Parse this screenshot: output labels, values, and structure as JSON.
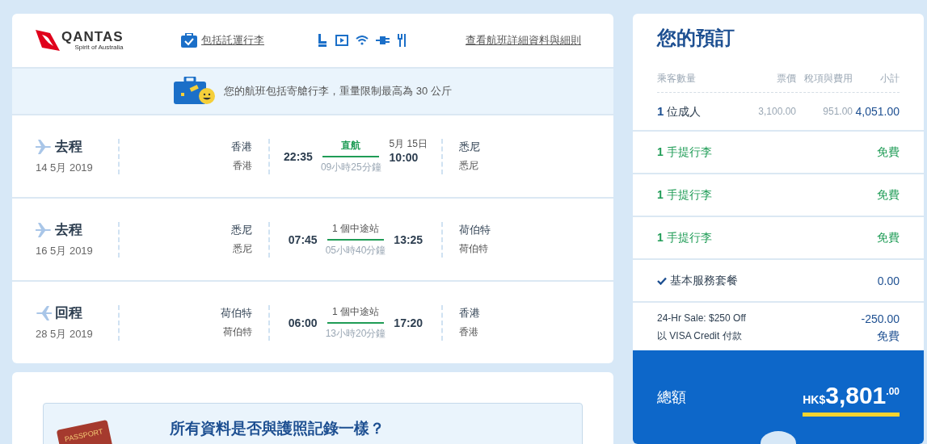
{
  "flight_card": {
    "logo": {
      "name": "QANTAS",
      "tagline": "Spirit of Australia"
    },
    "baggage_link": "包括託運行李",
    "details_link": "查看航班詳細資料與細則",
    "baggage_notice": "您的航班包括寄艙行李，重量限制最高為 30 公斤",
    "legs": [
      {
        "kind": "outbound",
        "label": "去程",
        "date": "14 5月 2019",
        "from_city": "香港",
        "from_airport": "香港",
        "depart": "22:35",
        "direct": true,
        "stops": "直航",
        "arrival_date": "5月 15日",
        "arrive": "10:00",
        "duration": "09小時25分鐘",
        "to_city": "悉尼",
        "to_airport": "悉尼"
      },
      {
        "kind": "outbound",
        "label": "去程",
        "date": "16 5月 2019",
        "from_city": "悉尼",
        "from_airport": "悉尼",
        "depart": "07:45",
        "direct": false,
        "stops": "1 個中途站",
        "arrive": "13:25",
        "duration": "05小時40分鐘",
        "to_city": "荷伯特",
        "to_airport": "荷伯特"
      },
      {
        "kind": "return",
        "label": "回程",
        "date": "28 5月 2019",
        "from_city": "荷伯特",
        "from_airport": "荷伯特",
        "depart": "06:00",
        "direct": false,
        "stops": "1 個中途站",
        "arrive": "17:20",
        "duration": "13小時20分鐘",
        "to_city": "香港",
        "to_airport": "香港"
      }
    ]
  },
  "passport_card": {
    "passport_label": "PASSPORT",
    "question": "所有資料是否與護照記錄一樣？"
  },
  "booking": {
    "title": "您的預訂",
    "columns": [
      "乘客數量",
      "票價",
      "稅項與費用",
      "小計"
    ],
    "passengers": {
      "count": "1",
      "label": "位成人",
      "fare": "3,100.00",
      "taxes": "951.00",
      "subtotal": "4,051.00"
    },
    "items": [
      {
        "kind": "baggage",
        "count": "1",
        "label": "手提行李",
        "price": "免費"
      },
      {
        "kind": "baggage",
        "count": "1",
        "label": "手提行李",
        "price": "免費"
      },
      {
        "kind": "baggage",
        "count": "1",
        "label": "手提行李",
        "price": "免費"
      },
      {
        "kind": "service",
        "label": "基本服務套餐",
        "price": "0.00"
      }
    ],
    "adjustments": [
      {
        "label": "24-Hr Sale: $250 Off",
        "value": "-250.00"
      },
      {
        "label": "以 VISA Credit 付款",
        "value": "免費"
      }
    ],
    "total": {
      "label": "總額",
      "currency": "HK$",
      "amount": "3,801",
      "cents": ".00"
    }
  }
}
